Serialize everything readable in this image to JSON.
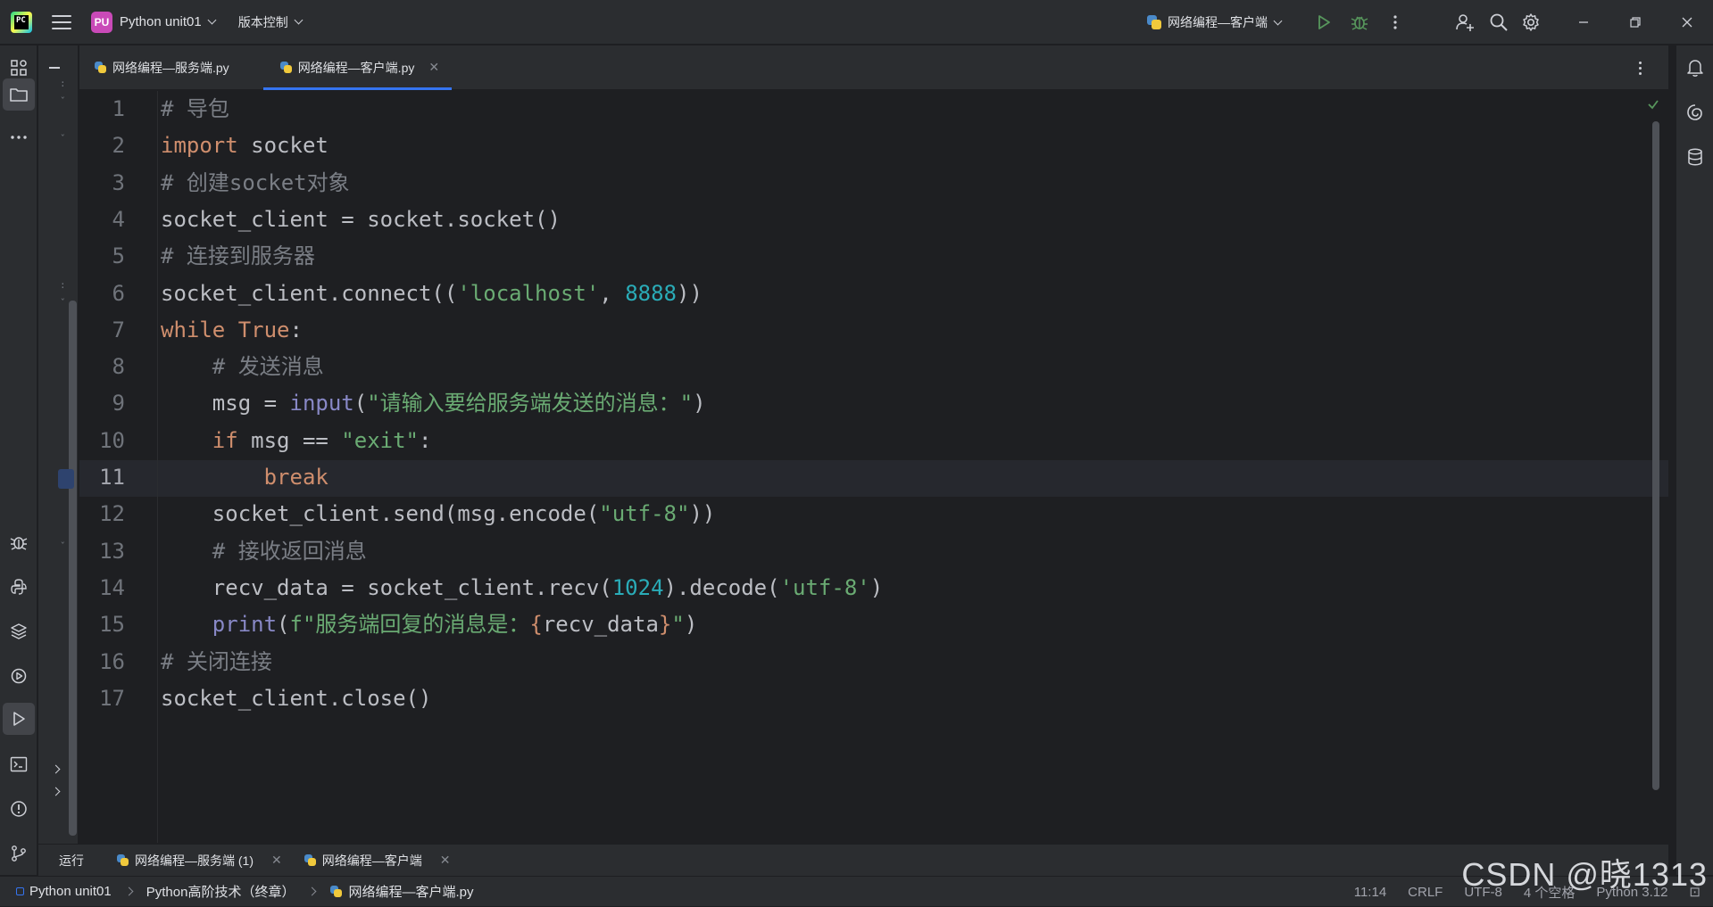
{
  "titlebar": {
    "project_badge": "PU",
    "project_name": "Python unit01",
    "vcs_label": "版本控制",
    "run_config": "网络编程—客户端"
  },
  "tabs": [
    {
      "label": "网络编程—服务端.py",
      "active": false
    },
    {
      "label": "网络编程—客户端.py",
      "active": true
    }
  ],
  "editor": {
    "current_line": 11,
    "lines": [
      {
        "n": "1",
        "html": "<span class='cm'># 导包</span>"
      },
      {
        "n": "2",
        "html": "<span class='kw'>import</span> socket"
      },
      {
        "n": "3",
        "html": "<span class='cm'># 创建socket对象</span>"
      },
      {
        "n": "4",
        "html": "socket_client = socket.socket()"
      },
      {
        "n": "5",
        "html": "<span class='cm'># 连接到服务器</span>"
      },
      {
        "n": "6",
        "html": "socket_client.connect((<span class='str'>'localhost'</span>, <span class='num'>8888</span>))"
      },
      {
        "n": "7",
        "html": "<span class='kw'>while</span> <span class='kw'>True</span>:"
      },
      {
        "n": "8",
        "html": "    <span class='cm'># 发送消息</span>"
      },
      {
        "n": "9",
        "html": "    msg = <span class='bi'>input</span>(<span class='str'>\"请输入要给服务端发送的消息：\"</span>)"
      },
      {
        "n": "10",
        "html": "    <span class='kw'>if</span> msg == <span class='str'>\"exit\"</span>:"
      },
      {
        "n": "11",
        "html": "        <span class='kw'>break</span>"
      },
      {
        "n": "12",
        "html": "    socket_client.send(msg.encode(<span class='str'>\"utf-8\"</span>))"
      },
      {
        "n": "13",
        "html": "    <span class='cm'># 接收返回消息</span>"
      },
      {
        "n": "14",
        "html": "    recv_data = socket_client.recv(<span class='num'>1024</span>).decode(<span class='str'>'utf-8'</span>)"
      },
      {
        "n": "15",
        "html": "    <span class='bi'>print</span>(<span class='str'>f\"服务端回复的消息是：</span><span class='fs'>{</span>recv_data<span class='fs'>}</span><span class='str'>\"</span>)"
      },
      {
        "n": "16",
        "html": "<span class='cm'># 关闭连接</span>"
      },
      {
        "n": "17",
        "html": "socket_client.close()"
      }
    ]
  },
  "run_panel": {
    "label": "运行",
    "tabs": [
      "网络编程—服务端 (1)",
      "网络编程—客户端"
    ]
  },
  "statusbar": {
    "breadcrumb": [
      "Python unit01",
      "Python高阶技术（终章）",
      "网络编程—客户端.py"
    ],
    "position": "11:14",
    "line_sep": "CRLF",
    "encoding": "UTF-8",
    "indent": "4 个空格",
    "interpreter": "Python 3.12"
  },
  "watermark": "CSDN @晓1313",
  "colors": {
    "accent": "#3574f0",
    "keyword": "#cf8e6d",
    "string": "#6aab73",
    "number": "#2aacb8",
    "comment": "#7a7e85"
  }
}
